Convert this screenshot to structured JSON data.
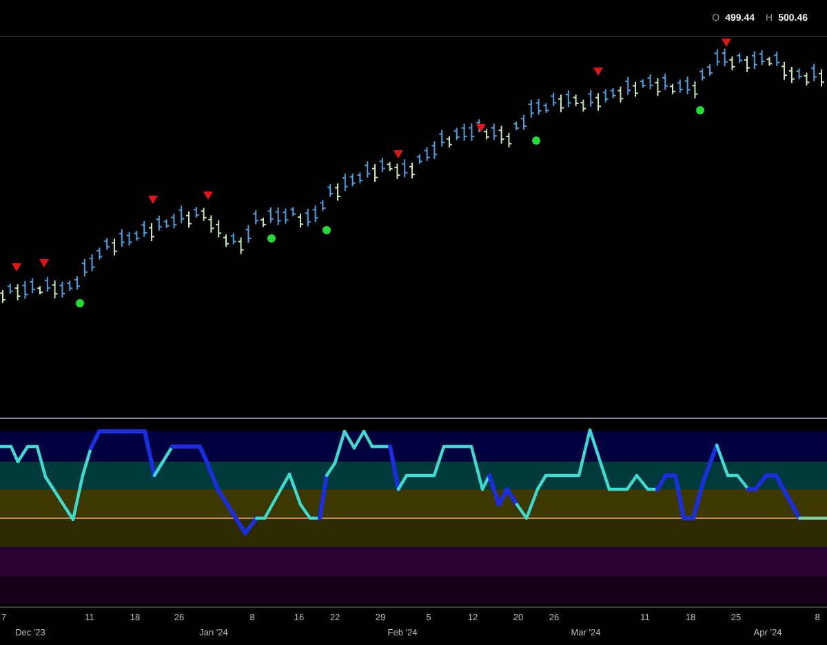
{
  "ohlc": [
    {
      "label": "O",
      "value": "499.44"
    },
    {
      "label": "H",
      "value": "500.46"
    }
  ],
  "x_axis": [
    {
      "label": "7",
      "kind": "day"
    },
    {
      "label": "Dec '23",
      "kind": "month"
    },
    {
      "label": "11",
      "kind": "day"
    },
    {
      "label": "18",
      "kind": "day"
    },
    {
      "label": "26",
      "kind": "day"
    },
    {
      "label": "Jan '24",
      "kind": "month"
    },
    {
      "label": "8",
      "kind": "day"
    },
    {
      "label": "16",
      "kind": "day"
    },
    {
      "label": "22",
      "kind": "day"
    },
    {
      "label": "29",
      "kind": "day"
    },
    {
      "label": "Feb '24",
      "kind": "month"
    },
    {
      "label": "5",
      "kind": "day"
    },
    {
      "label": "12",
      "kind": "day"
    },
    {
      "label": "20",
      "kind": "day"
    },
    {
      "label": "26",
      "kind": "day"
    },
    {
      "label": "Mar '24",
      "kind": "month"
    },
    {
      "label": "11",
      "kind": "day"
    },
    {
      "label": "18",
      "kind": "day"
    },
    {
      "label": "25",
      "kind": "day"
    },
    {
      "label": "Apr '24",
      "kind": "month"
    },
    {
      "label": "8",
      "kind": "day"
    }
  ]
}
